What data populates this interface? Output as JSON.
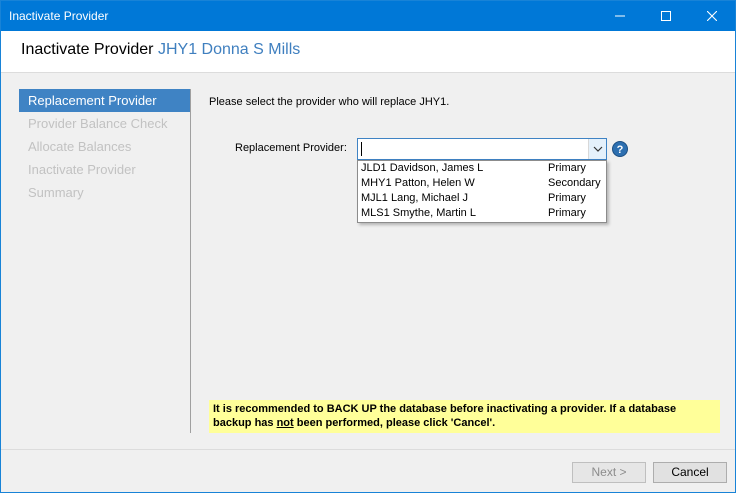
{
  "window": {
    "title": "Inactivate Provider"
  },
  "header": {
    "label": "Inactivate Provider",
    "provider_name": "JHY1 Donna S Mills"
  },
  "sidebar": {
    "items": [
      {
        "label": "Replacement Provider"
      },
      {
        "label": "Provider Balance Check"
      },
      {
        "label": "Allocate Balances"
      },
      {
        "label": "Inactivate Provider"
      },
      {
        "label": "Summary"
      }
    ]
  },
  "main": {
    "instruction": "Please select the provider who will replace JHY1.",
    "field_label": "Replacement Provider:",
    "field_value": "",
    "options": [
      {
        "name": "JLD1 Davidson, James L",
        "type": "Primary"
      },
      {
        "name": "MHY1 Patton, Helen W",
        "type": "Secondary"
      },
      {
        "name": "MJL1 Lang, Michael J",
        "type": "Primary"
      },
      {
        "name": "MLS1 Smythe, Martin L",
        "type": "Primary"
      }
    ],
    "help_glyph": "?",
    "warning_part1": "It is recommended to BACK UP the database before inactivating a provider. If a database backup has ",
    "warning_not": "not",
    "warning_part2": " been performed, please click 'Cancel'."
  },
  "footer": {
    "next_label": "Next >",
    "cancel_label": "Cancel"
  },
  "colors": {
    "titlebar": "#0078d7",
    "accent": "#3f83c4",
    "provider_name": "#3f7fbf",
    "warning_bg": "#ffff99"
  }
}
